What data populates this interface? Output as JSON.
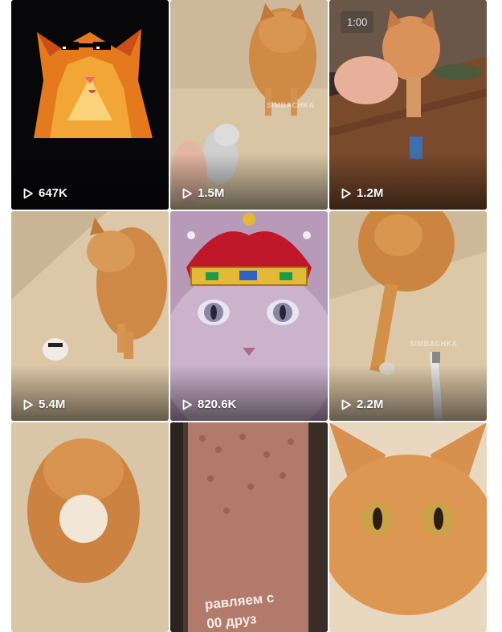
{
  "icons": {
    "play": "play-outline-icon"
  },
  "videos": [
    {
      "views": "647K"
    },
    {
      "views": "1.5M",
      "watermark": "SIMBACHKA"
    },
    {
      "views": "1.2M",
      "duration": "1:00"
    },
    {
      "views": "5.4M"
    },
    {
      "views": "820.6K"
    },
    {
      "views": "2.2M",
      "watermark": "SIMBACHKA"
    },
    {},
    {
      "overlay_line1": "равляем с",
      "overlay_line2": "00 друз"
    },
    {}
  ]
}
